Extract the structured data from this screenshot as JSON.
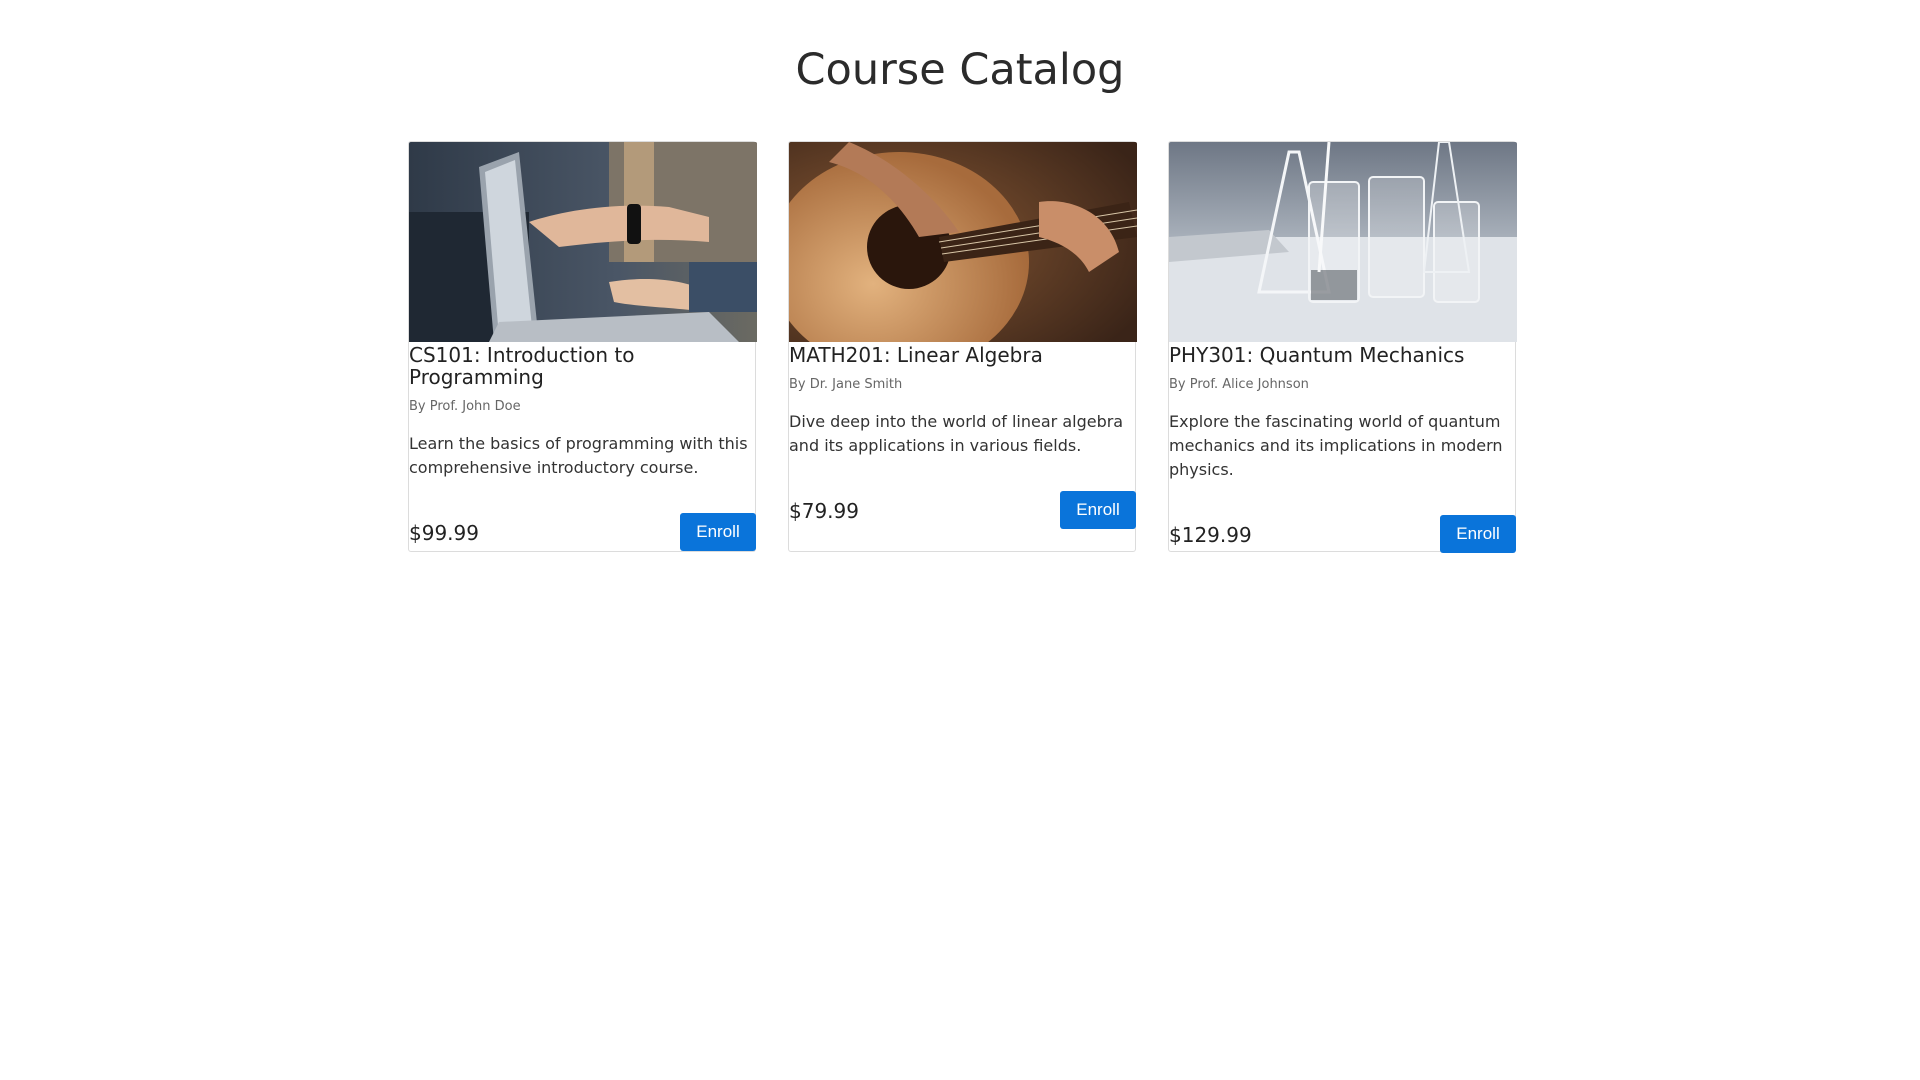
{
  "page": {
    "title": "Course Catalog"
  },
  "colors": {
    "accent": "#0a74da",
    "card_border": "#dcdcdc",
    "muted_text": "#666666"
  },
  "courses": [
    {
      "title": "CS101: Introduction to Programming",
      "instructor": "By Prof. John Doe",
      "description": "Learn the basics of programming with this comprehensive introductory course.",
      "price": "$99.99",
      "button_label": "Enroll",
      "image_icon": "laptop-photo-icon"
    },
    {
      "title": "MATH201: Linear Algebra",
      "instructor": "By Dr. Jane Smith",
      "description": "Dive deep into the world of linear algebra and its applications in various fields.",
      "price": "$79.99",
      "button_label": "Enroll",
      "image_icon": "guitar-photo-icon"
    },
    {
      "title": "PHY301: Quantum Mechanics",
      "instructor": "By Prof. Alice Johnson",
      "description": "Explore the fascinating world of quantum mechanics and its implications in modern physics.",
      "price": "$129.99",
      "button_label": "Enroll",
      "image_icon": "lab-glassware-photo-icon"
    }
  ]
}
